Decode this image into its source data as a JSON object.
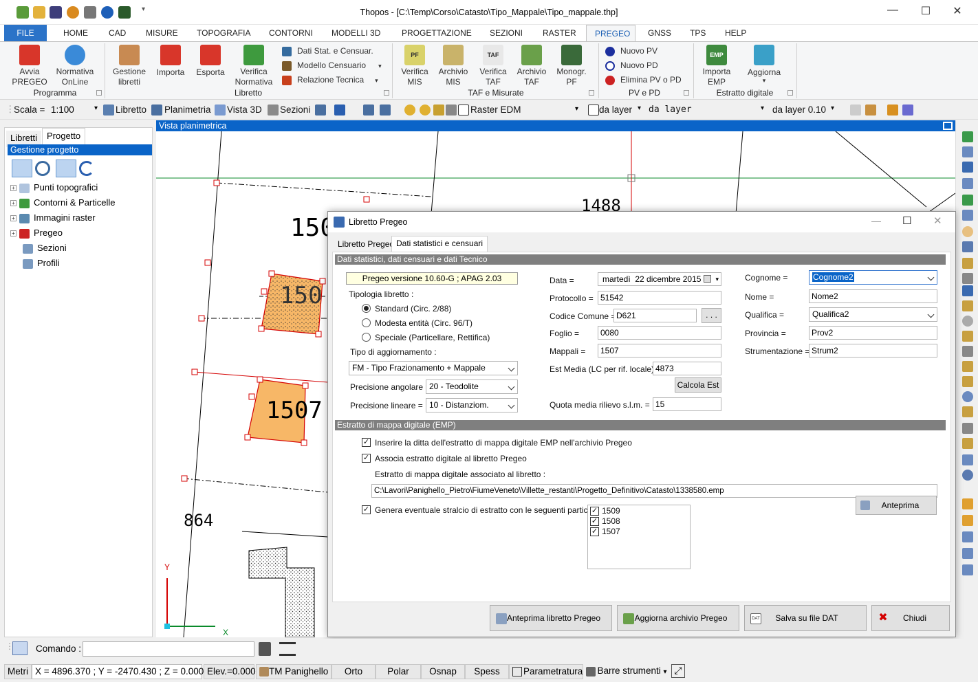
{
  "window": {
    "title": "Thopos - [C:\\Temp\\Corso\\Catasto\\Tipo_Mappale\\Tipo_mappale.thp]",
    "minimize": "—",
    "maximize": "☐",
    "close": "✕"
  },
  "ribbon_tabs": [
    {
      "label": "FILE"
    },
    {
      "label": "HOME"
    },
    {
      "label": "CAD"
    },
    {
      "label": "MISURE"
    },
    {
      "label": "TOPOGRAFIA"
    },
    {
      "label": "CONTORNI"
    },
    {
      "label": "MODELLI 3D"
    },
    {
      "label": "PROGETTAZIONE"
    },
    {
      "label": "SEZIONI"
    },
    {
      "label": "RASTER"
    },
    {
      "label": "PREGEO"
    },
    {
      "label": "GNSS"
    },
    {
      "label": "TPS"
    },
    {
      "label": "HELP"
    }
  ],
  "ribbon": {
    "programma": {
      "label": "Programma",
      "avvia_l1": "Avvia",
      "avvia_l2": "PREGEO",
      "normativa_l1": "Normativa",
      "normativa_l2": "OnLine"
    },
    "libretto": {
      "label": "Libretto",
      "gestione_l1": "Gestione",
      "gestione_l2": "libretti",
      "importa": "Importa",
      "esporta": "Esporta",
      "verifica_l1": "Verifica",
      "verifica_l2": "Normativa",
      "dati_stat": "Dati Stat. e Censuar.",
      "modello": "Modello Censuario",
      "relazione": "Relazione Tecnica"
    },
    "taf": {
      "label": "TAF e Misurate",
      "vmis_l1": "Verifica",
      "vmis_l2": "MIS",
      "amis_l1": "Archivio",
      "amis_l2": "MIS",
      "vtaf_l1": "Verifica",
      "vtaf_l2": "TAF",
      "ataf_l1": "Archivio",
      "ataf_l2": "TAF",
      "mono_l1": "Monogr.",
      "mono_l2": "PF",
      "pf_text": "PF",
      "taf_text": "TAF"
    },
    "pvpd": {
      "label": "PV e PD",
      "nuovo_pv": "Nuovo PV",
      "nuovo_pd": "Nuovo PD",
      "elimina": "Elimina PV o PD"
    },
    "estratto": {
      "label": "Estratto digitale",
      "importa_l1": "Importa",
      "importa_l2": "EMP",
      "aggiorna": "Aggiorna",
      "emp_text": "EMP"
    }
  },
  "toolbar": {
    "scala_label": "Scala =",
    "scala_value": "1:100",
    "libretto": "Libretto",
    "planimetria": "Planimetria",
    "vista3d": "Vista 3D",
    "sezioni": "Sezioni",
    "raster_edm": "Raster EDM",
    "da_layer": "da layer",
    "da_layer_mono": "da layer",
    "da_layer_val": "da layer 0.10"
  },
  "left_panel": {
    "tab_libretti": "Libretti",
    "tab_progetto": "Progetto",
    "header": "Gestione progetto",
    "tree": [
      {
        "label": "Punti topografici",
        "expandable": true
      },
      {
        "label": "Contorni & Particelle",
        "expandable": true
      },
      {
        "label": "Immagini raster",
        "expandable": true
      },
      {
        "label": "Pregeo",
        "expandable": true
      },
      {
        "label": "Sezioni",
        "expandable": false
      },
      {
        "label": "Profili",
        "expandable": false
      }
    ]
  },
  "view": {
    "header": "Vista planimetrica",
    "labels": {
      "p1488": "1488",
      "p150a": "150",
      "p150b": "150",
      "p1507": "1507",
      "p864": "864",
      "axis_y": "Y",
      "axis_x": "X"
    }
  },
  "dialog": {
    "title": "Libretto Pregeo",
    "tab1": "Libretto Pregeo",
    "tab2": "Dati statistici e censuari",
    "section1": "Dati statistici, dati censuari e dati Tecnico",
    "version": "Pregeo versione 10.60-G ; APAG 2.03",
    "tipologia_label": "Tipologia libretto :",
    "radio_standard": "Standard (Circ. 2/88)",
    "radio_modesta": "Modesta entità (Circ. 96/T)",
    "radio_speciale": "Speciale (Particellare, Rettifica)",
    "tipo_agg_label": "Tipo di aggiornamento :",
    "tipo_agg_value": "FM - Tipo Frazionamento + Mappale",
    "prec_ang_label": "Precisione angolare =",
    "prec_ang_value": "20 - Teodolite",
    "prec_lin_label": "Precisione lineare =",
    "prec_lin_value": "10 - Distanziom.",
    "data_label": "Data =",
    "data_day": "martedì",
    "data_value": "22 dicembre  2015",
    "protocollo_label": "Protocollo =",
    "protocollo_value": "51542",
    "codice_label": "Codice Comune =",
    "codice_value": "D621",
    "codice_btn": ". . .",
    "foglio_label": "Foglio =",
    "foglio_value": "0080",
    "mappali_label": "Mappali =",
    "mappali_value": "1507",
    "est_label": "Est Media (LC per rif. locale) =",
    "est_value": "4873",
    "calcola_btn": "Calcola Est",
    "quota_label": "Quota media rilievo s.l.m. =",
    "quota_value": "15",
    "cognome_label": "Cognome =",
    "cognome_value": "Cognome2",
    "nome_label": "Nome =",
    "nome_value": "Nome2",
    "qualifica_label": "Qualifica =",
    "qualifica_value": "Qualifica2",
    "provincia_label": "Provincia =",
    "provincia_value": "Prov2",
    "strumentazione_label": "Strumentazione =",
    "strumentazione_value": "Strum2",
    "section2": "Estratto di mappa digitale (EMP)",
    "chk_inserire": "Inserire la ditta dell'estratto di mappa digitale EMP nell'archivio Pregeo",
    "chk_associa": "Associa estratto digitale al libretto Pregeo",
    "estratto_label": "Estratto di mappa digitale associato al libretto :",
    "estratto_path": "C:\\Lavori\\Panighello_Pietro\\FiumeVeneto\\Villette_restanti\\Progetto_Definitivo\\Catasto\\1338580.emp",
    "chk_genera": "Genera eventuale stralcio di estratto con le seguenti particelle :",
    "particelle": [
      "1509",
      "1508",
      "1507"
    ],
    "anteprima_btn": "Anteprima",
    "btn_anteprima_libretto": "Anteprima libretto Pregeo",
    "btn_aggiorna": "Aggiorna archivio Pregeo",
    "btn_salva": "Salva su file DAT",
    "btn_chiudi": "Chiudi",
    "dat_icon": "DAT"
  },
  "command": {
    "label": "Comando :",
    "value": ""
  },
  "status": {
    "metri": "Metri",
    "coords": "X = 4896.370 ; Y = -2470.430 ; Z = 0.000",
    "elev": "Elev.=0.000",
    "tm": "TM Panighello",
    "orto": "Orto",
    "polar": "Polar",
    "osnap": "Osnap",
    "spess": "Spess",
    "param": "Parametratura",
    "barre": "Barre strumenti"
  },
  "colors": {
    "accent": "#0a64c8",
    "file_tab": "#2b73c8",
    "parcel_fill": "#f7b767",
    "parcel_edge": "#d40000"
  }
}
